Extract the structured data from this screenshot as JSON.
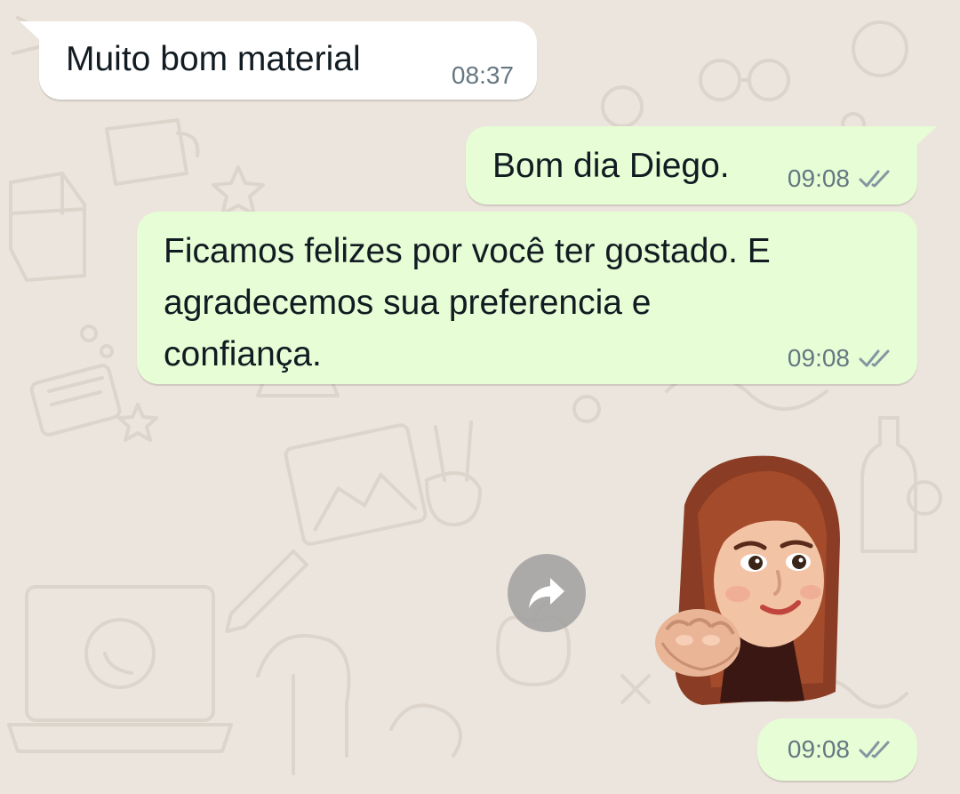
{
  "messages": [
    {
      "direction": "incoming",
      "text": "Muito bom material",
      "time": "08:37"
    },
    {
      "direction": "outgoing",
      "text": "Bom dia Diego.",
      "time": "09:08",
      "status": "read"
    },
    {
      "direction": "outgoing",
      "text": "Ficamos felizes por você ter gostado. E\nagradecemos sua preferencia e\nconfiança.",
      "time": "09:08",
      "status": "read"
    },
    {
      "direction": "outgoing",
      "type": "sticker",
      "sticker": "memoji-woman-fist-bump",
      "time": "09:08",
      "status": "read"
    }
  ],
  "icons": {
    "forward": "forward-arrow-icon",
    "double_check": "double-check-icon"
  },
  "colors": {
    "chat_background": "#ece5dd",
    "incoming_bubble": "#ffffff",
    "outgoing_bubble": "#e6fdd6",
    "timestamp": "#667781",
    "forward_button": "#a0a0a0"
  }
}
